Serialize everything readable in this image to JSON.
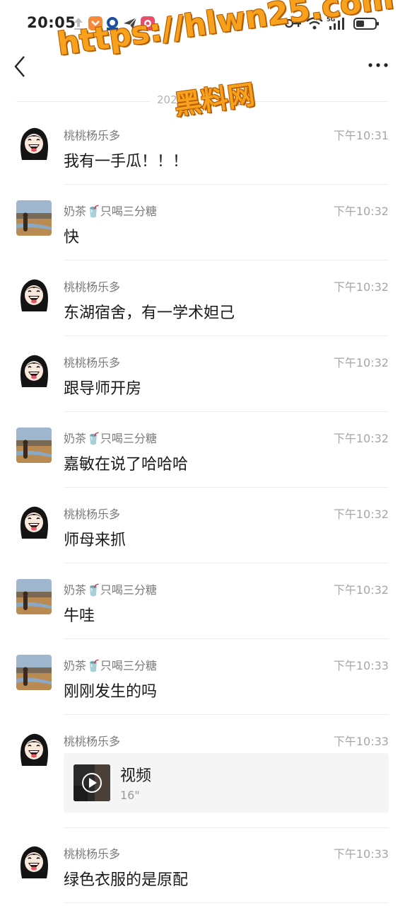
{
  "status_bar": {
    "time": "20:05"
  },
  "date_separator": "202",
  "date_separator_suffix": "日",
  "watermark": {
    "url": "https://hlwn25.com",
    "text": "黑料网"
  },
  "messages": [
    {
      "sender": "桃桃杨乐多",
      "time": "下午10:31",
      "text": "我有一手瓜！！！"
    },
    {
      "sender": "奶茶🥤只喝三分糖",
      "time": "下午10:32",
      "text": "快"
    },
    {
      "sender": "桃桃杨乐多",
      "time": "下午10:32",
      "text": "东湖宿舍，有一学术妲己"
    },
    {
      "sender": "桃桃杨乐多",
      "time": "下午10:32",
      "text": "跟导师开房"
    },
    {
      "sender": "奶茶🥤只喝三分糖",
      "time": "下午10:32",
      "text": "嘉敏在说了哈哈哈"
    },
    {
      "sender": "桃桃杨乐多",
      "time": "下午10:32",
      "text": "师母来抓"
    },
    {
      "sender": "奶茶🥤只喝三分糖",
      "time": "下午10:32",
      "text": "牛哇"
    },
    {
      "sender": "奶茶🥤只喝三分糖",
      "time": "下午10:33",
      "text": "刚刚发生的吗"
    },
    {
      "sender": "桃桃杨乐多",
      "time": "下午10:33",
      "video": {
        "label": "视频",
        "duration": "16\""
      }
    },
    {
      "sender": "桃桃杨乐多",
      "time": "下午10:33",
      "text": "绿色衣服的是原配"
    }
  ],
  "colors": {
    "sender": "#7a7a7a",
    "time": "#a6a6a6",
    "divider": "#ededed",
    "watermark": "#f7a11c"
  }
}
